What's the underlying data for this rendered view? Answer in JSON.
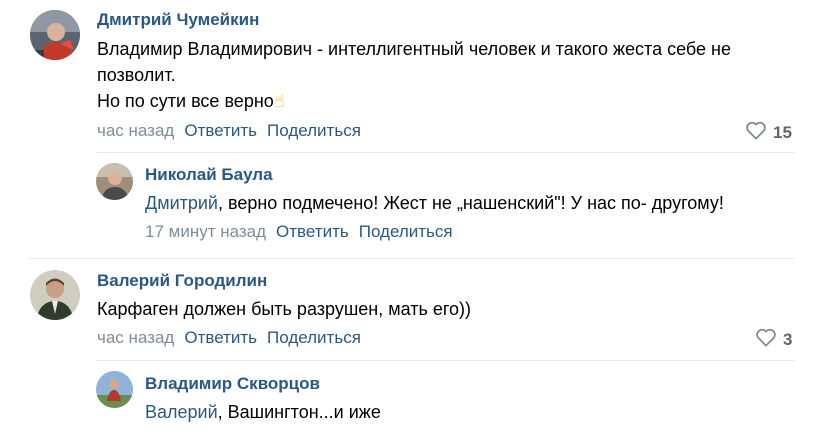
{
  "colors": {
    "link": "#2a5885",
    "meta": "#818c99",
    "divider": "#e7e8ec"
  },
  "comments": [
    {
      "author": "Дмитрий Чумейкин",
      "line1": "Владимир Владимирович - интеллигентный человек и такого жеста себе не",
      "line2": "позволит.",
      "line3": "Но по сути все верно",
      "emoji": "☝",
      "time": "час назад",
      "reply": "Ответить",
      "share": "Поделиться",
      "likes": "15",
      "like_icon": "heart-outline-icon"
    },
    {
      "author": "Николай Баула",
      "mention": "Дмитрий",
      "text": ", верно подмечено! Жест не „нашенский\"! У нас по- другому!",
      "time": "17 минут назад",
      "reply": "Ответить",
      "share": "Поделиться"
    },
    {
      "author": "Валерий Городилин",
      "text": "Карфаген должен быть разрушен, мать его))",
      "time": "час назад",
      "reply": "Ответить",
      "share": "Поделиться",
      "likes": "3",
      "like_icon": "heart-outline-icon"
    },
    {
      "author": "Владимир Скворцов",
      "mention": "Валерий",
      "text": ", Вашингтон...и иже"
    }
  ]
}
